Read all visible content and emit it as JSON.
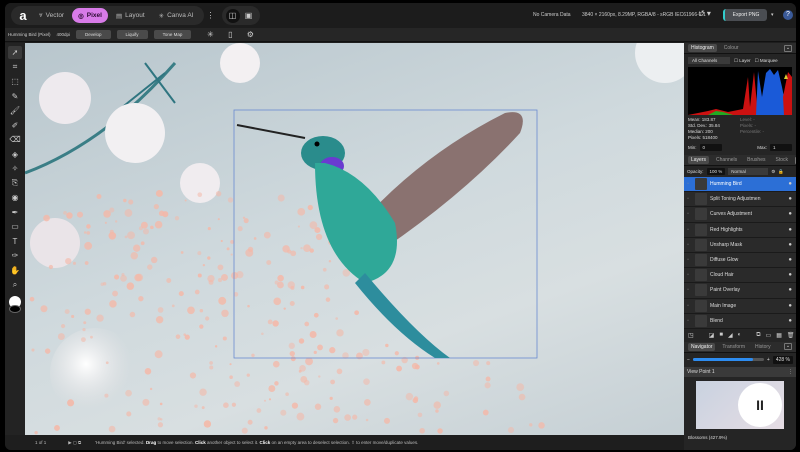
{
  "topbar": {
    "logo": "a",
    "personas": [
      {
        "label": "Vector",
        "icon": "vector-icon"
      },
      {
        "label": "Pixel",
        "icon": "pixel-icon",
        "active": true
      },
      {
        "label": "Layout",
        "icon": "layout-icon"
      },
      {
        "label": "Canva AI",
        "icon": "canva-ai-icon"
      }
    ],
    "camera": "No Camera Data",
    "doc_info": "3840 × 2160px, 8.29MP, RGBA/8 - sRGB IEC61966-2.1",
    "export_label": "Export PNG",
    "help": "?"
  },
  "context": {
    "layer_name": "Humming Bird (Pixel)",
    "dpi": "400dpi",
    "buttons": [
      "Develop",
      "Liquify",
      "Tone Map"
    ]
  },
  "histogram": {
    "tabs": [
      "Histogram",
      "Colour"
    ],
    "channel": "All Channels",
    "layer_label": "Layer",
    "marquee_label": "Marquee",
    "stats": {
      "mean": "Mean: 183.87",
      "std": "Std. Dev.: 35.84",
      "median": "Median: 200",
      "pixels": "Pixels: 518400"
    },
    "right_stats": {
      "level": "Level: -",
      "pixels": "Pixels: -",
      "percentile": "Percentile: -"
    },
    "min_label": "Min:",
    "min": "0",
    "max_label": "Max:",
    "max": "1"
  },
  "layers": {
    "tabs": [
      "Layers",
      "Channels",
      "Brushes",
      "Stock"
    ],
    "opacity_label": "Opacity:",
    "opacity": "100 %",
    "blend": "Normal",
    "items": [
      {
        "name": "Humming Bird",
        "selected": true
      },
      {
        "name": "Split Toning Adjustmen"
      },
      {
        "name": "Curves Adjustment"
      },
      {
        "name": "Red Highlights"
      },
      {
        "name": "Unsharp Mask"
      },
      {
        "name": "Diffuse Glow"
      },
      {
        "name": "Cloud Hair"
      },
      {
        "name": "Paint Overlay"
      },
      {
        "name": "Main Image"
      },
      {
        "name": "Blend"
      }
    ]
  },
  "navigator": {
    "tabs": [
      "Navigator",
      "Transform",
      "History"
    ],
    "zoom": "428 %",
    "zoom_fraction": 0.85,
    "viewpoint": "View Point 1",
    "footer": "Blossoms (427.9%)"
  },
  "status": {
    "page": "1 of 1",
    "msg": [
      {
        "t": "'Humming Bird' selected. "
      },
      {
        "t": "Drag",
        "b": true
      },
      {
        "t": " to move selection. "
      },
      {
        "t": "Click",
        "b": true
      },
      {
        "t": " another object to select it. "
      },
      {
        "t": "Click",
        "b": true
      },
      {
        "t": " on an empty area to deselect selection. ⇧ to enter move/duplicate values."
      }
    ]
  }
}
